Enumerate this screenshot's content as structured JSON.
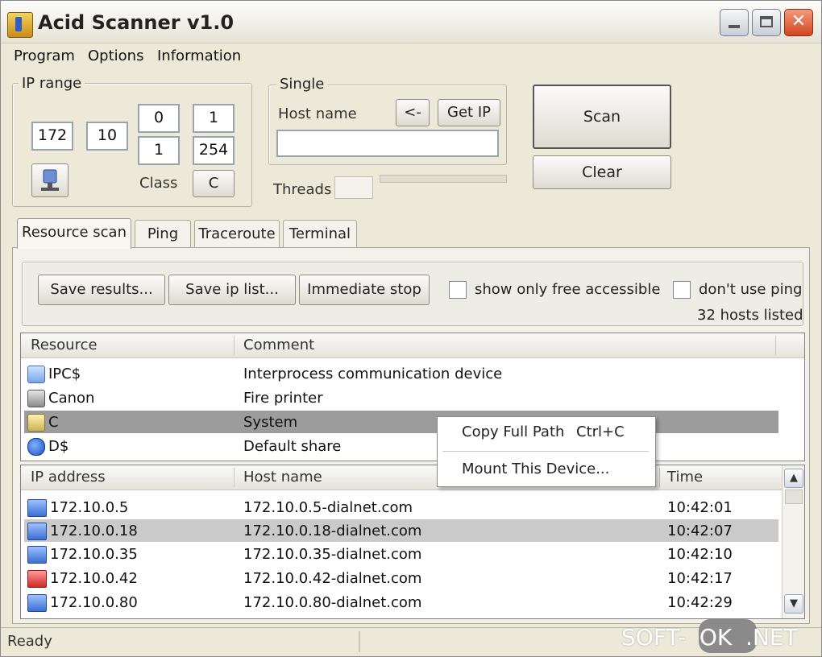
{
  "window": {
    "title": "Acid Scanner v1.0",
    "close_glyph": "✕"
  },
  "menu": {
    "items": [
      "Program",
      "Options",
      "Information"
    ]
  },
  "ip_range": {
    "label": "IP range",
    "octet1": "172",
    "octet2": "10",
    "octet3_start": "0",
    "octet3_end": "1",
    "octet4_start": "1",
    "octet4_end": "254",
    "class_label": "Class",
    "class_value": "C"
  },
  "single": {
    "label": "Single",
    "host_label": "Host name",
    "arrow_button": "<-",
    "getip_button": "Get IP",
    "host_value": "",
    "threads_label": "Threads"
  },
  "actions": {
    "scan": "Scan",
    "clear": "Clear"
  },
  "tabs": [
    "Resource scan",
    "Ping",
    "Traceroute",
    "Terminal"
  ],
  "toolbar": {
    "save_results": "Save results...",
    "save_ip_list": "Save ip list...",
    "immediate_stop": "Immediate stop",
    "show_free_label": "show only free accessible",
    "dont_ping_label": "don't use ping",
    "hosts_listed": "32 hosts listed"
  },
  "resources": {
    "headers": [
      "Resource",
      "Comment"
    ],
    "rows": [
      {
        "name": "IPC$",
        "comment": "Interprocess communication device",
        "icon": "ipc-icon"
      },
      {
        "name": "Canon",
        "comment": "Fire printer",
        "icon": "printer-icon"
      },
      {
        "name": "C",
        "comment": "System",
        "icon": "drive-icon"
      },
      {
        "name": "D$",
        "comment": "Default share",
        "icon": "share-icon"
      }
    ]
  },
  "context_menu": {
    "copy_label": "Copy Full Path",
    "copy_shortcut": "Ctrl+C",
    "mount_label": "Mount This Device..."
  },
  "hosts": {
    "headers": [
      "IP address",
      "Host name",
      "Time"
    ],
    "rows": [
      {
        "ip": "172.10.0.5",
        "host": "172.10.0.5-dialnet.com",
        "time": "10:42:01",
        "icon": "host-icon"
      },
      {
        "ip": "172.10.0.18",
        "host": "172.10.0.18-dialnet.com",
        "time": "10:42:07",
        "icon": "host-icon"
      },
      {
        "ip": "172.10.0.35",
        "host": "172.10.0.35-dialnet.com",
        "time": "10:42:10",
        "icon": "host-icon"
      },
      {
        "ip": "172.10.0.42",
        "host": "172.10.0.42-dialnet.com",
        "time": "10:42:17",
        "icon": "host-alert-icon"
      },
      {
        "ip": "172.10.0.80",
        "host": "172.10.0.80-dialnet.com",
        "time": "10:42:29",
        "icon": "host-icon"
      }
    ]
  },
  "status": {
    "text": "Ready"
  },
  "watermark": {
    "left": "SOFT-",
    "ok": "OK",
    "right": ".NET"
  }
}
